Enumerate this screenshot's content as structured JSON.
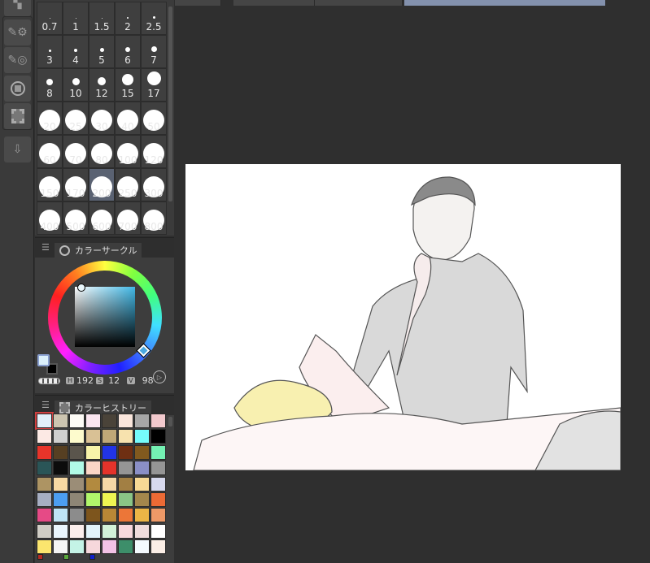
{
  "tabs": [
    {
      "label": "",
      "active": false
    },
    {
      "label": "",
      "active": false
    },
    {
      "label": "",
      "active": false
    },
    {
      "label": "",
      "active": true
    }
  ],
  "toolbar": {
    "icons": [
      "layer-property-icon",
      "sub-tool-settings-icon",
      "sub-tool-detail-icon",
      "color-circle-icon",
      "animation-timeline-icon",
      "import-material-icon"
    ]
  },
  "brush_sizes": [
    "0.7",
    "1",
    "1.5",
    "2",
    "2.5",
    "3",
    "4",
    "5",
    "6",
    "7",
    "8",
    "10",
    "12",
    "15",
    "17",
    "20",
    "25",
    "30",
    "40",
    "50",
    "60",
    "70",
    "80",
    "100",
    "120",
    "150",
    "170",
    "200",
    "250",
    "300",
    "400",
    "500",
    "600",
    "700",
    "800"
  ],
  "brush_selected": "200",
  "color_circle": {
    "title": "カラーサークル",
    "h_label": "H",
    "h": "192",
    "s_label": "S",
    "s": "12",
    "v_label": "V",
    "v": "98",
    "main_color": "#dcf0fb",
    "sub_color": "#000000"
  },
  "color_history": {
    "title": "カラーヒストリー",
    "swatches": [
      "#e2f0fa",
      "#cdc5b0",
      "#fdfbf6",
      "#fbe6f0",
      "#4a4339",
      "#fae6dc",
      "#a6a6a6",
      "#f2c9cd",
      "#fce9e4",
      "#cfcfcf",
      "#fdfbcd",
      "#d9c195",
      "#c0a877",
      "#f7e2ae",
      "#75fbfb",
      "#000000",
      "#e8342a",
      "#563f22",
      "#5a554c",
      "#f7f3a9",
      "#2234e6",
      "#6e2f12",
      "#81591e",
      "#74f1b3",
      "#2a5557",
      "#0c0c0c",
      "#b1fbe7",
      "#fbd6c6",
      "#e5332b",
      "#959595",
      "#8a8fc6",
      "#959595",
      "#ad9463",
      "#f7d9a3",
      "#9b8d77",
      "#b28a3f",
      "#f6d8a7",
      "#a27f43",
      "#f7d995",
      "#d7d9ee",
      "#a6aec2",
      "#4c9ef1",
      "#8e8676",
      "#b1f66b",
      "#eef552",
      "#8ac586",
      "#a4874c",
      "#ec6a35",
      "#e64a86",
      "#bfe5f6",
      "#8c8c8c",
      "#7d551d",
      "#b98736",
      "#ec7638",
      "#ecb546",
      "#ee9967",
      "#d0cdc5",
      "#eaf6fd",
      "#fbeeec",
      "#e2f4fb",
      "#d3f2d8",
      "#f8d8dc",
      "#f0dcdc",
      "#ffffff",
      "#fbe56e",
      "#f4f4f4",
      "#c4f3e6",
      "#f6d8dc",
      "#f2c2e6",
      "#3d8e6a",
      "#f4fafe",
      "#fbeee6"
    ],
    "recent": [
      "#b52a22",
      "#5aa83c",
      "#1020c8"
    ]
  },
  "colors": {
    "accent": "#5a6272",
    "canvas": "#ffffff"
  }
}
